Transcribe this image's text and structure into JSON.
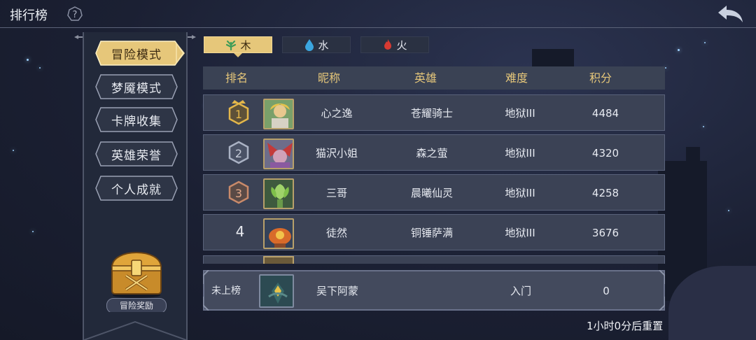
{
  "header": {
    "title": "排行榜",
    "help_icon": "help-icon",
    "back_icon": "back-arrow-icon"
  },
  "sidebar": {
    "items": [
      {
        "label": "冒险模式",
        "active": true
      },
      {
        "label": "梦魇模式",
        "active": false
      },
      {
        "label": "卡牌收集",
        "active": false
      },
      {
        "label": "英雄荣誉",
        "active": false
      },
      {
        "label": "个人成就",
        "active": false
      }
    ],
    "reward_label": "冒险奖励"
  },
  "tabs": [
    {
      "label": "木",
      "icon": "leaf-icon",
      "color": "#4fb36a",
      "active": true
    },
    {
      "label": "水",
      "icon": "water-drop-icon",
      "color": "#3ba6e0",
      "active": false
    },
    {
      "label": "火",
      "icon": "fire-icon",
      "color": "#d83a32",
      "active": false
    }
  ],
  "table": {
    "headers": [
      "排名",
      "昵称",
      "英雄",
      "难度",
      "积分"
    ],
    "rows": [
      {
        "rank": "1",
        "nickname": "心之逸",
        "hero": "苍耀骑士",
        "difficulty": "地狱III",
        "score": "4484",
        "medal": "gold"
      },
      {
        "rank": "2",
        "nickname": "猫沢小姐",
        "hero": "森之萤",
        "difficulty": "地狱III",
        "score": "4320",
        "medal": "silver"
      },
      {
        "rank": "3",
        "nickname": "三哥",
        "hero": "晨曦仙灵",
        "difficulty": "地狱III",
        "score": "4258",
        "medal": "bronze"
      },
      {
        "rank": "4",
        "nickname": "徒然",
        "hero": "铜锤萨满",
        "difficulty": "地狱III",
        "score": "3676",
        "medal": "none"
      }
    ]
  },
  "my_rank": {
    "rank_label": "未上榜",
    "nickname": "吴下阿蒙",
    "difficulty": "入门",
    "score": "0"
  },
  "reset_text": "1小时0分后重置",
  "colors": {
    "accent_gold": "#e6c77a",
    "panel": "#3b4255",
    "background": "#1b2033"
  }
}
